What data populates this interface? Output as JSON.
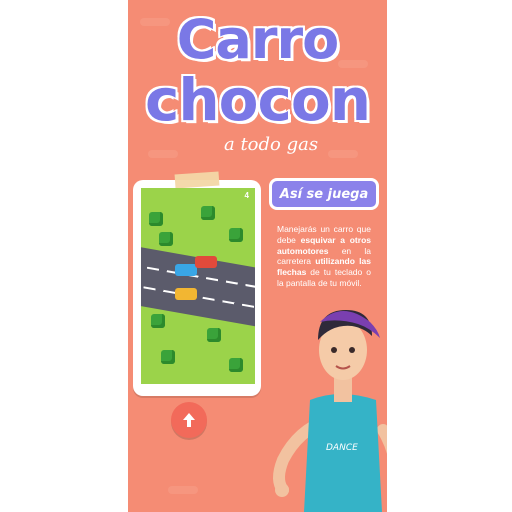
{
  "title": {
    "line1": "Carro",
    "line2": "chocon",
    "tagline": "a todo gas"
  },
  "game_preview": {
    "level_counter": "4",
    "up_button_icon": "arrow-up-icon"
  },
  "howto": {
    "button_label": "Así se juega",
    "desc_part1": "Manejarás un carro que debe ",
    "desc_bold1": "esquivar a otros automotores",
    "desc_part2": " en la carretera ",
    "desc_bold2": "utilizando las flechas",
    "desc_part3": " de tu teclado o la pantalla de tu móvil."
  },
  "character": {
    "shirt_text": "DANCE"
  },
  "colors": {
    "panel_bg": "#f58c74",
    "title": "#7a78e6",
    "howto_button": "#8b82ea",
    "up_button": "#f26a5a"
  }
}
